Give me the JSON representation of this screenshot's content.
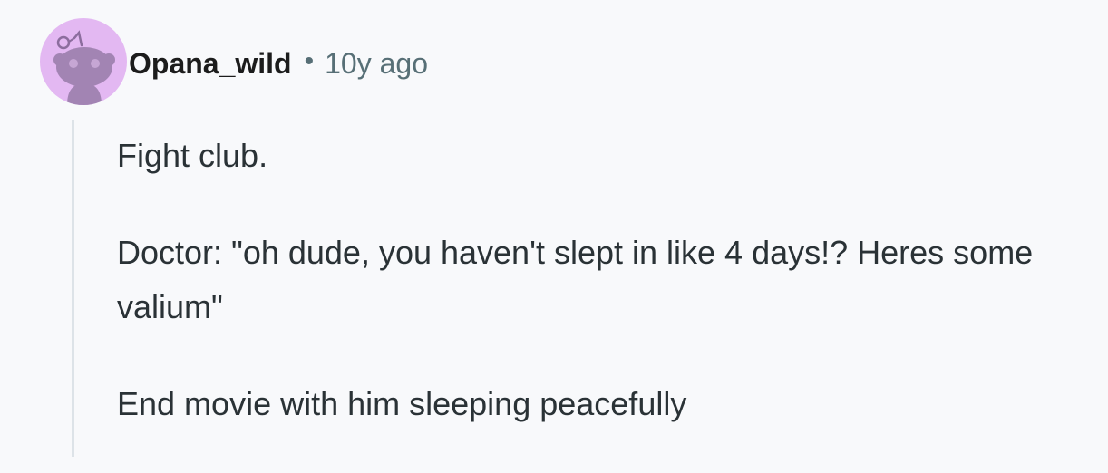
{
  "comment": {
    "author": "Opana_wild",
    "separator": "•",
    "age": "10y ago",
    "avatar_icon": "snoo-avatar-icon",
    "avatar_bg": "#e3b8f2",
    "paragraphs": [
      "Fight club.",
      "Doctor: \"oh dude, you haven't slept in like 4 days!? Heres some valium\"",
      "End movie with him sleeping peacefully"
    ]
  }
}
